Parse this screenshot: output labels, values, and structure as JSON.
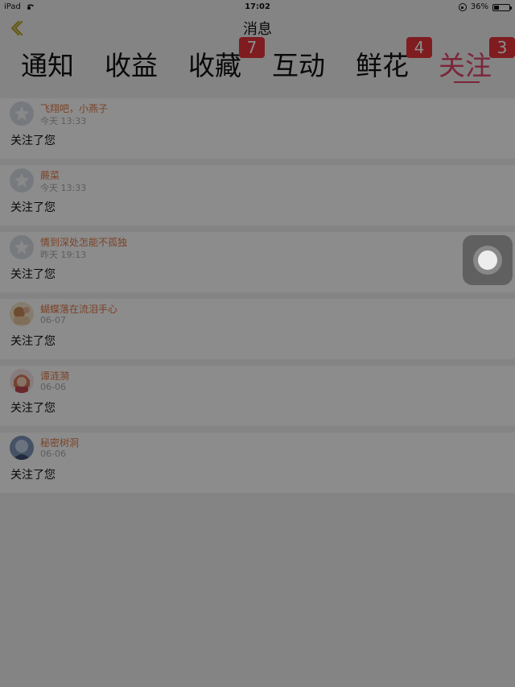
{
  "status_bar": {
    "device": "iPad",
    "time": "17:02",
    "battery_text": "36%",
    "battery_level": 0.36
  },
  "nav": {
    "title": "消息",
    "back_icon": "chevron-left-icon"
  },
  "tabs": [
    {
      "label": "通知",
      "badge": ""
    },
    {
      "label": "收益",
      "badge": ""
    },
    {
      "label": "收藏",
      "badge": "7"
    },
    {
      "label": "互动",
      "badge": ""
    },
    {
      "label": "鲜花",
      "badge": "4"
    },
    {
      "label": "关注",
      "badge": "3",
      "active": true
    }
  ],
  "colors": {
    "accent": "#e0456b",
    "badge": "#e8333b",
    "username": "#e07a4a",
    "overlay": "rgba(0,0,0,0.45)"
  },
  "messages": [
    {
      "user": "飞翔吧，小燕子",
      "time": "今天 13:33",
      "text": "关注了您",
      "avatar": "default-avatar-icon"
    },
    {
      "user": "蕨菜",
      "time": "今天 13:33",
      "text": "关注了您",
      "avatar": "default-avatar-icon"
    },
    {
      "user": "情到深处怎能不孤独",
      "time": "昨天 19:13",
      "text": "关注了您",
      "avatar": "default-avatar-icon"
    },
    {
      "user": "蝴蝶落在流泪手心",
      "time": "06-07",
      "text": "关注了您",
      "avatar": "photo-avatar"
    },
    {
      "user": "谭涟漪",
      "time": "06-06",
      "text": "关注了您",
      "avatar": "photo-avatar"
    },
    {
      "user": "秘密树洞",
      "time": "06-06",
      "text": "关注了您",
      "avatar": "photo-avatar"
    }
  ]
}
